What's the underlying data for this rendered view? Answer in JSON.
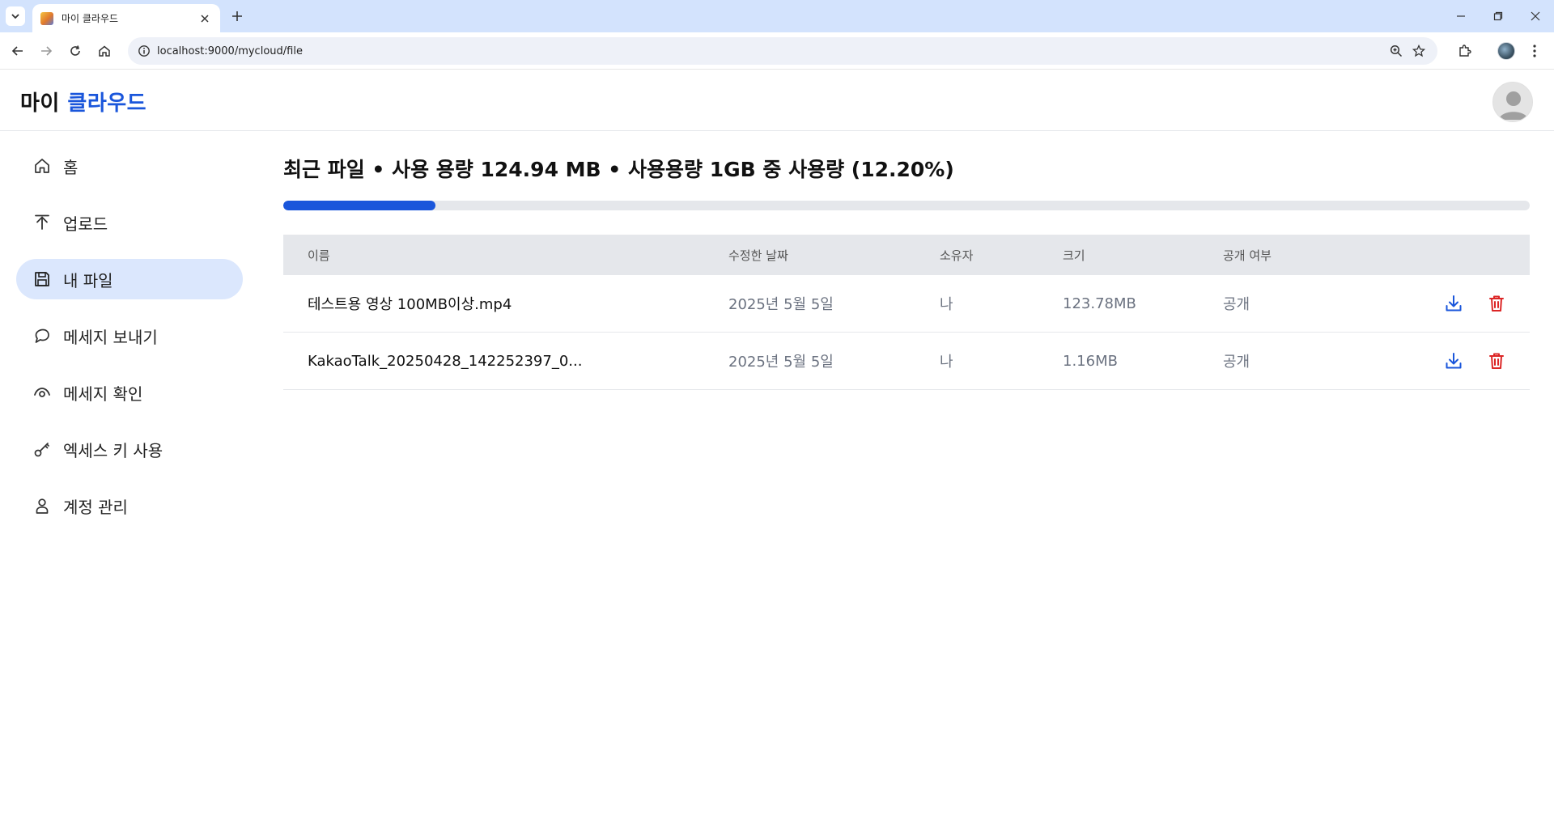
{
  "browser": {
    "tab_title": "마이 클라우드",
    "url": "localhost:9000/mycloud/file"
  },
  "app": {
    "brand_part1": "마이",
    "brand_part2": "클라우드",
    "brand_accent_color": "#1a56db"
  },
  "sidebar": {
    "items": [
      {
        "label": "홈",
        "icon": "home-icon",
        "active": false
      },
      {
        "label": "업로드",
        "icon": "upload-icon",
        "active": false
      },
      {
        "label": "내 파일",
        "icon": "floppy-disk-icon",
        "active": true
      },
      {
        "label": "메세지 보내기",
        "icon": "chat-bubble-icon",
        "active": false
      },
      {
        "label": "메세지 확인",
        "icon": "eye-icon",
        "active": false
      },
      {
        "label": "엑세스 키 사용",
        "icon": "key-icon",
        "active": false
      },
      {
        "label": "계정 관리",
        "icon": "user-icon",
        "active": false
      }
    ]
  },
  "main": {
    "title": "최근 파일 • 사용 용량 124.94 MB • 사용용량 1GB 중 사용량 (12.20%)",
    "usage_fraction": 0.122,
    "table": {
      "headers": [
        "이름",
        "수정한 날짜",
        "소유자",
        "크기",
        "공개 여부"
      ],
      "rows": [
        {
          "name": "테스트용 영상 100MB이상.mp4",
          "date": "2025년 5월 5일",
          "owner": "나",
          "size": "123.78MB",
          "public": "공개"
        },
        {
          "name": "KakaoTalk_20250428_142252397_0...",
          "date": "2025년 5월 5일",
          "owner": "나",
          "size": "1.16MB",
          "public": "공개"
        }
      ],
      "download_color": "#1a56db",
      "delete_color": "#dc2626"
    }
  }
}
